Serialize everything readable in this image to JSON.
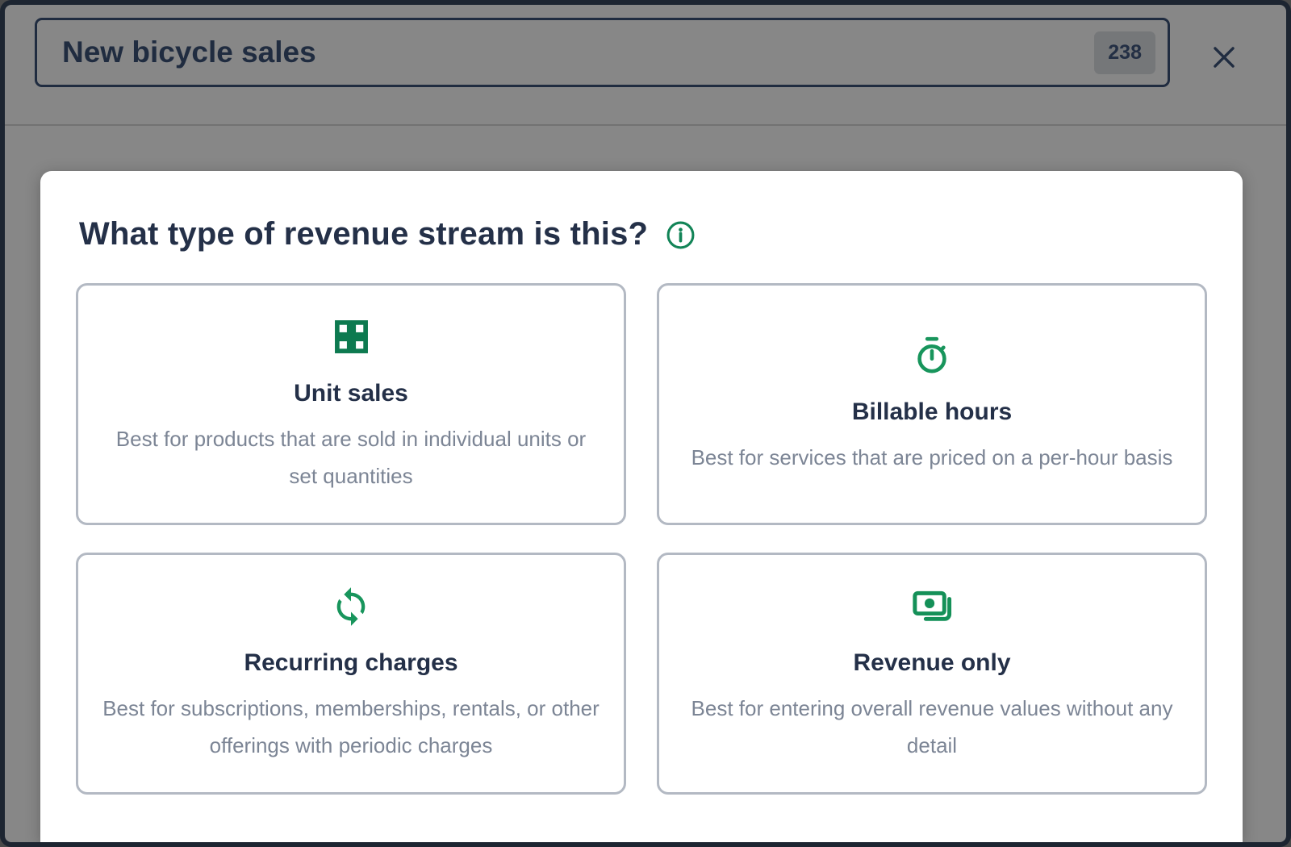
{
  "header": {
    "input": {
      "value": "New bicycle sales",
      "char_count": "238"
    },
    "close_icon": "close-icon"
  },
  "modal": {
    "title": "What type of revenue stream is this?",
    "info_icon": "info-icon",
    "options": [
      {
        "icon": "grid-icon",
        "title": "Unit sales",
        "description": "Best for products that are sold in individual units or set quantities"
      },
      {
        "icon": "stopwatch-icon",
        "title": "Billable hours",
        "description": "Best for services that are priced on a per-hour basis"
      },
      {
        "icon": "refresh-cycle-icon",
        "title": "Recurring charges",
        "description": "Best for subscriptions, memberships, rentals, or other offerings with periodic charges"
      },
      {
        "icon": "banknote-icon",
        "title": "Revenue only",
        "description": "Best for entering overall revenue values without any detail"
      }
    ]
  },
  "colors": {
    "accent_green": "#18955c",
    "accent_green_dark": "#0d7a50",
    "navy_text": "#243048",
    "muted_text": "#7c8595",
    "card_border": "#b3b9c3",
    "overlay_background": "#878787",
    "frame_border": "#1d2531",
    "panel_background": "#ffffff"
  }
}
